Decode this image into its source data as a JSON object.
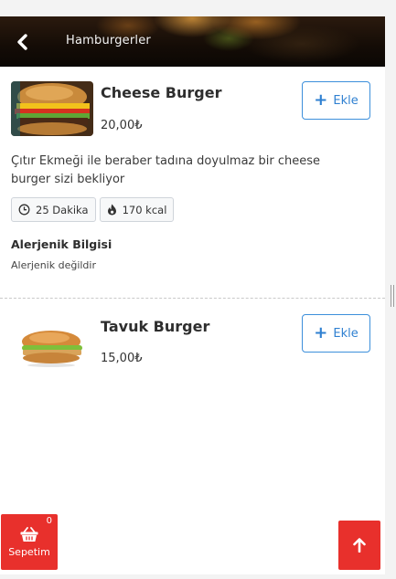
{
  "header": {
    "title": "Hamburgerler",
    "back_icon": "chevron-left-icon"
  },
  "products": [
    {
      "name": "Cheese Burger",
      "price": "20,00₺",
      "add_label": "Ekle",
      "description": "Çıtır Ekmeği ile beraber tadına doyulmaz bir cheese burger sizi bekliyor",
      "badges": [
        {
          "icon": "clock-icon",
          "label": "25 Dakika"
        },
        {
          "icon": "flame-icon",
          "label": "170 kcal"
        }
      ],
      "allergen_title": "Alerjenik Bilgisi",
      "allergen_value": "Alerjenik değildir"
    },
    {
      "name": "Tavuk Burger",
      "price": "15,00₺",
      "add_label": "Ekle"
    }
  ],
  "cart": {
    "label": "Sepetim",
    "count": "0",
    "icon": "shopping-basket-icon"
  },
  "scroll_top": {
    "icon": "arrow-up-icon"
  },
  "colors": {
    "accent_blue": "#2f80d1",
    "accent_red": "#e8302c"
  }
}
